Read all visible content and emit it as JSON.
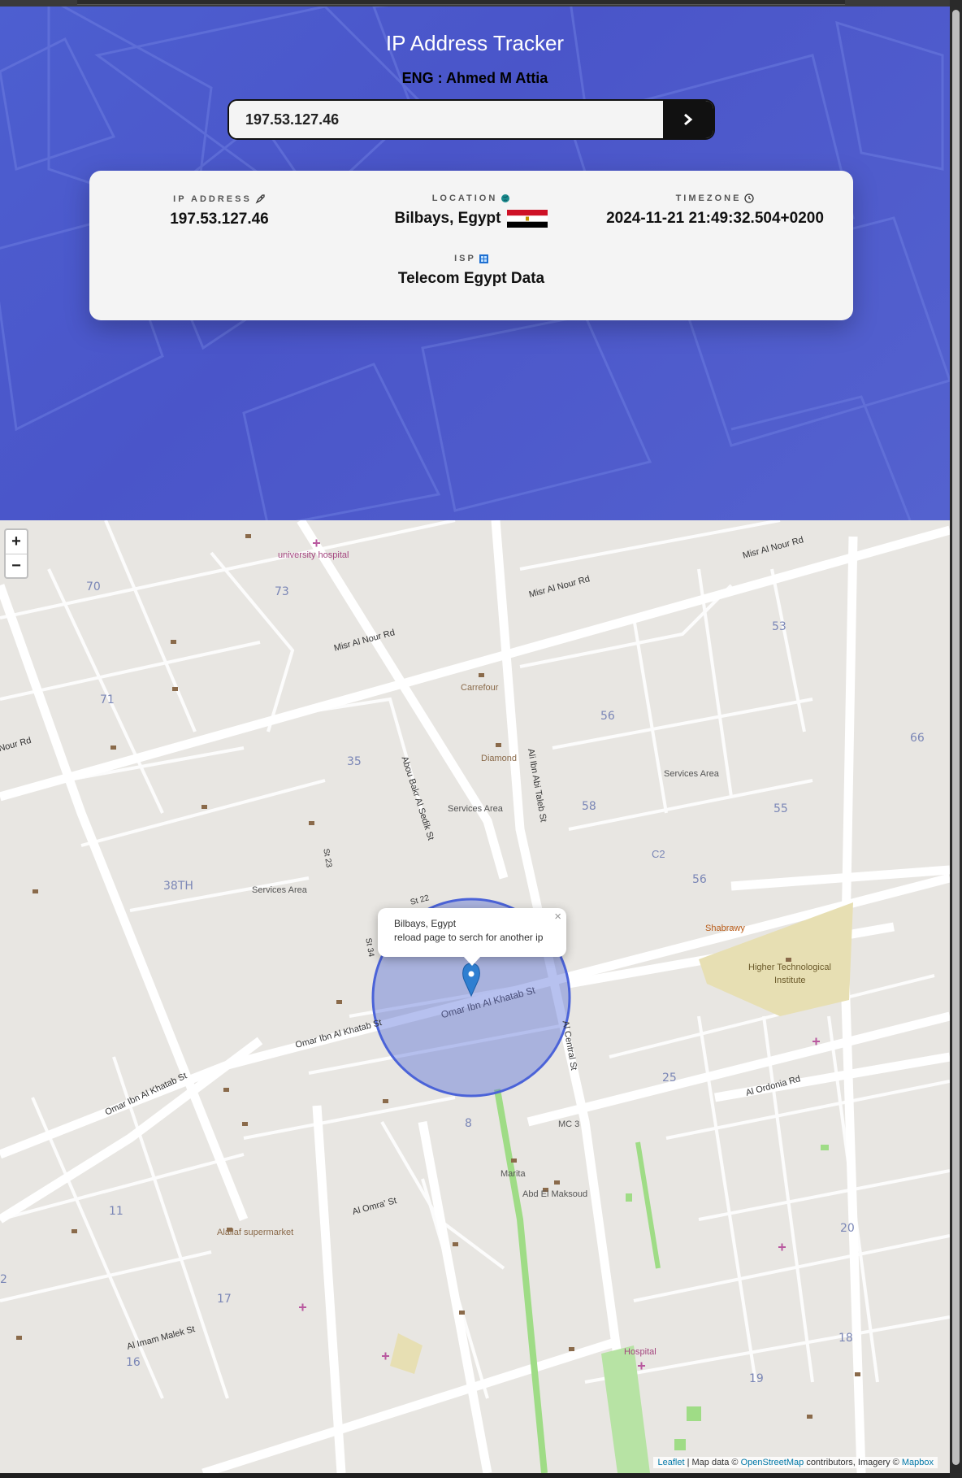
{
  "header": {
    "title": "IP Address Tracker",
    "subtitle": "ENG : Ahmed M Attia",
    "search_value": "197.53.127.46",
    "submit_icon": "chevron-right-icon"
  },
  "info": {
    "ip_label": "IP ADDRESS",
    "ip_value": "197.53.127.46",
    "location_label": "LOCATION",
    "location_value": "Bilbays, Egypt",
    "timezone_label": "TIMEZONE",
    "timezone_value": "2024-11-21 21:49:32.504+0200",
    "isp_label": "ISP",
    "isp_value": "Telecom Egypt Data",
    "icons": {
      "ip": "rocket-icon",
      "location": "globe-icon",
      "timezone": "clock-icon",
      "isp": "building-icon",
      "flag": "egypt-flag-icon"
    }
  },
  "map": {
    "zoom_in": "+",
    "zoom_out": "−",
    "popup_line1": "Bilbays, Egypt",
    "popup_line2": "reload page to serch for another ip",
    "popup_close": "×",
    "circle_color": "#4b63d8",
    "labels": {
      "university_hospital": "university hospital",
      "misr_al_nour_rd_1": "Misr Al Nour Rd",
      "misr_al_nour_rd_2": "Misr Al Nour Rd",
      "misr_al_nour_rd_3": "Misr Al Nour Rd",
      "nour_rd": "Nour Rd",
      "carrefour": "Carrefour",
      "diamond": "Diamond",
      "services_area_1": "Services Area",
      "services_area_2": "Services Area",
      "services_area_3": "Services Area",
      "abou_bakr": "Abou Bakr Al Sedik St",
      "ali_ibn_abi_taleb": "Ali Ibn Abi Taleb St",
      "shabrawy": "Shabrawy",
      "higher_tech": "Higher Technological",
      "institute": "Institute",
      "omar_ibn_al_khatab_1": "Omar Ibn Al Khatab St",
      "omar_ibn_al_khatab_2": "Omar Ibn Al Khatab St",
      "omar_ibn_al_khatab_3": "Omar Ibn Al Khatab St",
      "al_central": "Al Central St",
      "mc3": "MC 3",
      "marita": "Marita",
      "abd_el_maksoud": "Abd El Maksoud",
      "alallaf": "Alallaf supermarket",
      "al_omra": "Al Omra' St",
      "hospital": "Hospital",
      "c2": "C2",
      "st_22": "St 22",
      "st_23": "St 23",
      "st_34": "St 34",
      "al_ordonia": "Al Ordonia Rd",
      "al_imam_malek": "Al Imam Malek St",
      "leaflet": "Leaflet",
      "map_data": "| Map data ©",
      "osm": "OpenStreetMap",
      "contrib": "contributors, Imagery ©",
      "mapbox": "Mapbox"
    }
  }
}
